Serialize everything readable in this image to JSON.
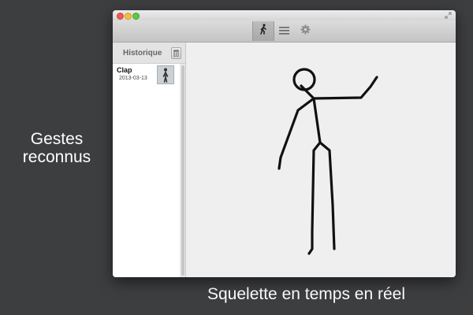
{
  "captions": {
    "recognized": "Gestes reconnus",
    "skeleton": "Squelette en temps en réel"
  },
  "toolbar": {
    "buttons": [
      {
        "icon": "walking-person-icon",
        "active": true
      },
      {
        "icon": "list-icon",
        "active": false
      },
      {
        "icon": "gear-icon",
        "active": false
      }
    ]
  },
  "sidebar": {
    "title": "Historique",
    "trash_icon": "trash-icon",
    "items": [
      {
        "name": "Clap",
        "date": "2013-03-13",
        "icon": "standing-person-icon"
      }
    ]
  },
  "colors": {
    "desktop": "#3d3e40",
    "window": "#efefef",
    "skeleton": "#111111"
  }
}
